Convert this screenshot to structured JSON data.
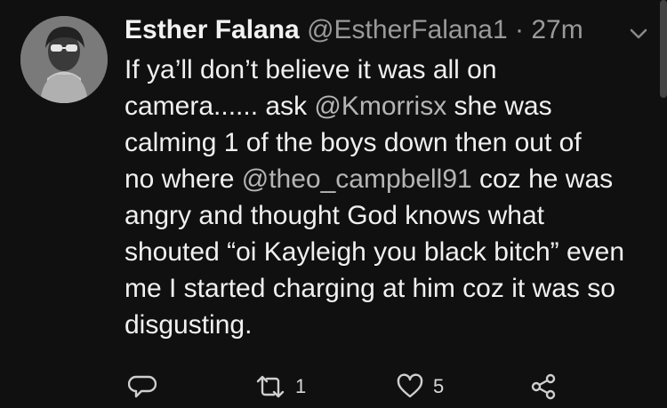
{
  "tweet": {
    "display_name": "Esther Falana",
    "handle": "@EstherFalana1",
    "separator": "·",
    "time": "27m",
    "lines": [
      [
        "If ya’ll don’t believe it was all on"
      ],
      [
        "camera...... ask ",
        "@Kmorrisx",
        " she was"
      ],
      [
        "calming 1 of the boys down then out of"
      ],
      [
        "no where ",
        "@theo_campbell91",
        " coz he was"
      ],
      [
        "angry and thought God knows what"
      ],
      [
        "shouted “oi Kayleigh you black bitch” even"
      ],
      [
        "me I started charging at him coz it was so"
      ],
      [
        "disgusting."
      ]
    ],
    "line_texts": {
      "l1": "If ya’ll don’t believe it was all on",
      "l2a": "camera...... ask ",
      "l2b": "@Kmorrisx",
      "l2c": " she was",
      "l3": "calming 1 of the boys down then out of",
      "l4a": "no where ",
      "l4b": "@theo_campbell91",
      "l4c": " coz he was",
      "l5": "angry and thought God knows what",
      "l6": "shouted “oi Kayleigh you black bitch” even",
      "l7": "me I started charging at him coz it was so",
      "l8": "disgusting."
    }
  },
  "actions": {
    "reply_icon": "reply-icon",
    "retweet_icon": "retweet-icon",
    "retweet_count": "1",
    "like_icon": "heart-icon",
    "like_count": "5",
    "share_icon": "share-icon"
  },
  "colors": {
    "background": "#101010",
    "text": "#f0f0f0",
    "muted": "#9a9a9a"
  }
}
